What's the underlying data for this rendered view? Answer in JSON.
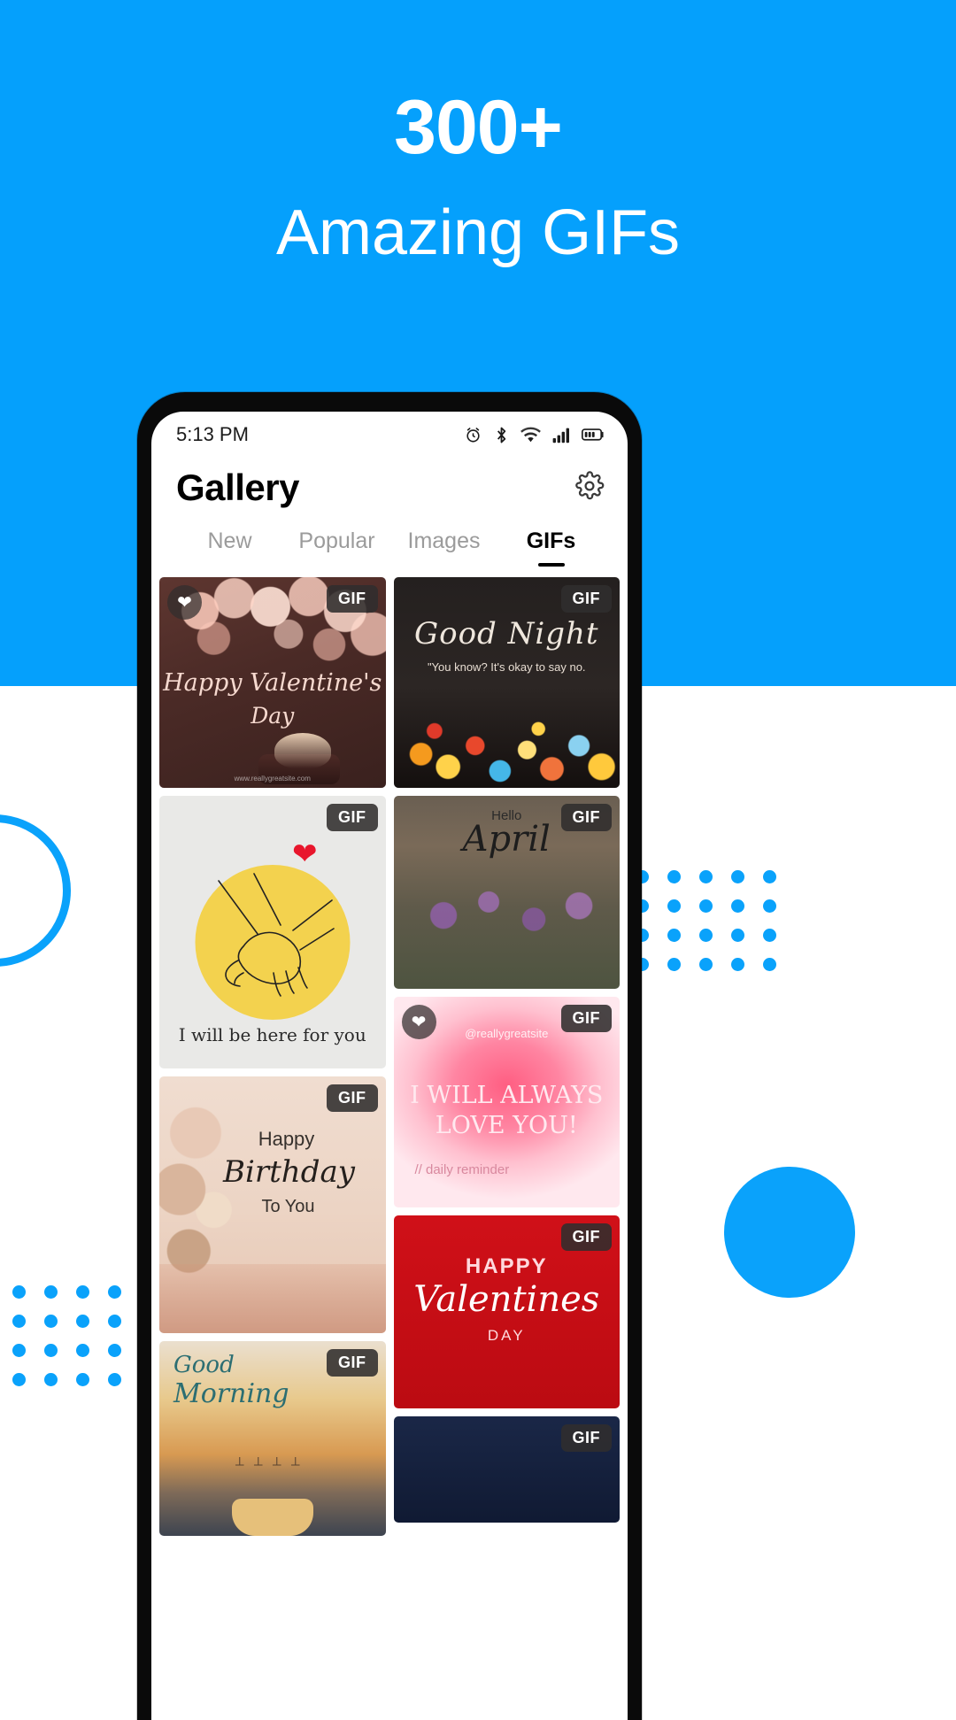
{
  "hero": {
    "title": "300+",
    "subtitle": "Amazing GIFs",
    "band_color": "#05a0fc",
    "accent_color": "#0aa2fb",
    "text_color": "#ffffff"
  },
  "decor": {
    "ring_label": "circle-outline",
    "blob_label": "filled-circle",
    "dots_right_label": "dot-grid-right",
    "dots_left_label": "dot-grid-left"
  },
  "phone": {
    "statusbar": {
      "time": "5:13 PM",
      "icons": [
        "alarm-icon",
        "bluetooth-icon",
        "wifi-icon",
        "cellular-signal-icon",
        "battery-icon"
      ]
    },
    "appbar": {
      "title": "Gallery",
      "settings_icon": "gear-icon"
    },
    "tabs": [
      {
        "label": "New",
        "active": false
      },
      {
        "label": "Popular",
        "active": false
      },
      {
        "label": "Images",
        "active": false
      },
      {
        "label": "GIFs",
        "active": true
      }
    ],
    "badges": {
      "gif": "GIF",
      "favorite_icon": "heart-icon"
    },
    "tiles": [
      {
        "id": "valentines-day",
        "badge": "GIF",
        "favorited": true,
        "caption_1": "Happy Valentine's",
        "caption_2": "Day",
        "caption_3": "www.reallygreatsite.com"
      },
      {
        "id": "good-night",
        "badge": "GIF",
        "favorited": false,
        "caption_1": "Good Night",
        "caption_2": "\"You know? It's okay to say no."
      },
      {
        "id": "holding-hands",
        "badge": "GIF",
        "favorited": false,
        "caption_1": "I will be here for you"
      },
      {
        "id": "hello-april",
        "badge": "GIF",
        "favorited": false,
        "caption_1": "Hello",
        "caption_2": "April"
      },
      {
        "id": "i-will-always-love-you",
        "badge": "GIF",
        "favorited": true,
        "caption_0": "@reallygreatsite",
        "caption_1": "I WILL ALWAYS",
        "caption_2": "LOVE YOU!",
        "caption_3": "// daily reminder"
      },
      {
        "id": "happy-birthday",
        "badge": "GIF",
        "favorited": false,
        "caption_1": "Happy",
        "caption_2": "Birthday",
        "caption_3": "To You"
      },
      {
        "id": "happy-valentines",
        "badge": "GIF",
        "favorited": false,
        "caption_1": "HAPPY",
        "caption_2": "Valentines",
        "caption_3": "DAY"
      },
      {
        "id": "good-morning",
        "badge": "GIF",
        "favorited": false,
        "caption_1": "Good",
        "caption_2": "Morning"
      },
      {
        "id": "night-scene",
        "badge": "GIF",
        "favorited": false
      }
    ]
  }
}
